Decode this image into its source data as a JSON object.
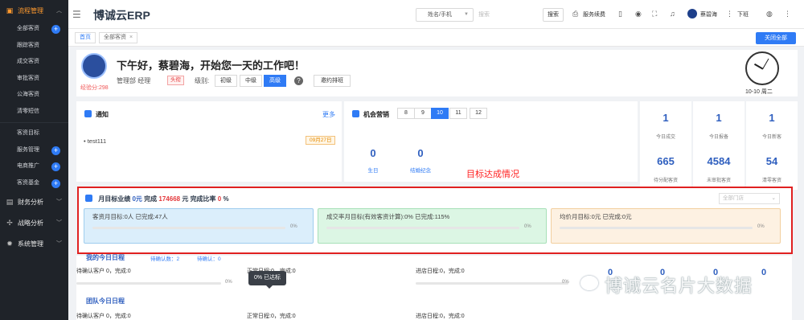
{
  "sidebar": {
    "groups": [
      {
        "label": "流程管理",
        "items": [
          "全部客资",
          "跟踪客资",
          "成交客资",
          "审批客资",
          "公海客资",
          "清零短信"
        ]
      },
      {
        "items": [
          "客资目标",
          "服务管理",
          "电商推广",
          "客资基金"
        ]
      },
      {
        "label": "财务分析"
      },
      {
        "label": "战略分析"
      },
      {
        "label": "系统管理"
      }
    ]
  },
  "topbar": {
    "brand": "博诚云ERP",
    "search_field": "姓名/手机",
    "search_placeholder": "搜索",
    "search_button": "搜索",
    "service_fee": "服务续费",
    "user_name": "蔡碧海",
    "logout": "下班"
  },
  "tabs": {
    "home": "首页",
    "all": "全部客资",
    "close_all": "关闭全部"
  },
  "welcome": {
    "greeting": "下午好，蔡碧海，开始您一天的工作吧！",
    "experience": "经验分:298",
    "department": "管理部 经理",
    "rank": "头衔",
    "level_label": "级别:",
    "levels": [
      "初级",
      "中级",
      "高级"
    ],
    "selected_level": "高级",
    "help": "?",
    "invite": "邀约排班",
    "date": "10-10 周二"
  },
  "notice": {
    "title": "通知",
    "more": "更多",
    "items": [
      {
        "text": "• test111",
        "date": "09月27日"
      }
    ]
  },
  "marketing": {
    "title": "机会营销",
    "months": [
      "8",
      "9",
      "10",
      "11",
      "12"
    ],
    "selected_month": "10",
    "metrics": [
      {
        "value": "0",
        "label": "生日"
      },
      {
        "value": "0",
        "label": "结婚纪念"
      }
    ]
  },
  "stats": [
    {
      "value": "1",
      "label": "今日成交"
    },
    {
      "value": "1",
      "label": "今日报备"
    },
    {
      "value": "1",
      "label": "今日新客"
    },
    {
      "value": "665",
      "label": "待分配客资"
    },
    {
      "value": "4584",
      "label": "未审批客资"
    },
    {
      "value": "54",
      "label": "清零客资"
    }
  ],
  "annotation": "目标达成情况",
  "monthly_target": {
    "label": "月目标业绩",
    "target": "0元",
    "done_label": "完成",
    "done_value": "174668",
    "unit": "元",
    "rate_label": "完成比率",
    "rate_value": "0",
    "rate_unit": "%",
    "select_placeholder": "全部门店",
    "boxes": [
      {
        "text": "客资月目标:0人  已完成:47人",
        "percent": "0%",
        "progress": 0,
        "color": "#c3e3f7"
      },
      {
        "text": "成交率月目标(有效客资计算):0%  已完成:115%",
        "percent": "0%",
        "progress": 0,
        "color": "#d4f3dc"
      },
      {
        "text": "均价月目标:0元  已完成:0元",
        "percent": "0%",
        "progress": 0,
        "color": "#fdeedd"
      }
    ]
  },
  "schedule": {
    "mine_title": "我的今日日程",
    "mine_sub1": "待确认数：2",
    "mine_sub2": "待确认：0",
    "row1": [
      "待确认客户 0，完成:0",
      "正常日程:0，完成:0",
      "进店日程:0，完成:0"
    ],
    "row_pct": "0%",
    "tooltip": "0% 已达标",
    "team_title": "团队今日日程",
    "row2": [
      "待确认客户 0，完成:0",
      "正常日程:0，完成:0",
      "进店日程:0，完成:0"
    ],
    "zeros": [
      "0",
      "0",
      "0",
      "0"
    ]
  },
  "watermark": "博诚云名片大数据"
}
